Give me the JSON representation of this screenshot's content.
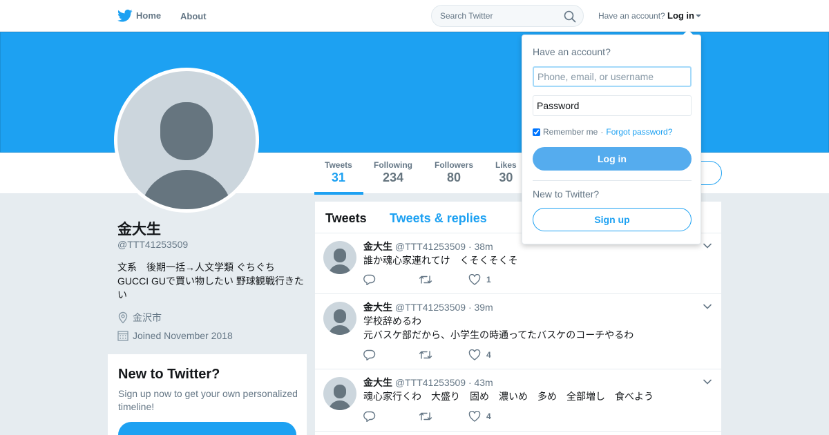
{
  "nav": {
    "home": "Home",
    "about": "About",
    "search_placeholder": "Search Twitter",
    "have_account": "Have an account?",
    "login": "Log in"
  },
  "stats": [
    {
      "label": "Tweets",
      "value": "31"
    },
    {
      "label": "Following",
      "value": "234"
    },
    {
      "label": "Followers",
      "value": "80"
    },
    {
      "label": "Likes",
      "value": "30"
    }
  ],
  "profile": {
    "name": "金大生",
    "handle": "@TTT41253509",
    "bio": "文系　後期一括→人文学類 ぐちぐち GUCCI GUで買い物したい 野球観戦行きたい",
    "location": "金沢市",
    "joined": "Joined November 2018"
  },
  "new_to_twitter": {
    "title": "New to Twitter?",
    "text": "Sign up now to get your own personalized timeline!"
  },
  "timeline": {
    "tabs": [
      "Tweets",
      "Tweets & replies"
    ],
    "tweets": [
      {
        "name": "金大生",
        "handle": "@TTT41253509",
        "time": "· 38m",
        "lines": [
          "誰か魂心家連れてけ　くそくそくそ"
        ],
        "likes": "1"
      },
      {
        "name": "金大生",
        "handle": "@TTT41253509",
        "time": "· 39m",
        "lines": [
          "学校辞めるわ",
          "元バスケ部だから、小学生の時通ってたバスケのコーチやるわ"
        ],
        "likes": "4"
      },
      {
        "name": "金大生",
        "handle": "@TTT41253509",
        "time": "· 43m",
        "lines": [
          "魂心家行くわ　大盛り　固め　濃いめ　多め　全部増し　食べよう"
        ],
        "likes": "4"
      }
    ]
  },
  "login_dropdown": {
    "title": "Have an account?",
    "username_placeholder": "Phone, email, or username",
    "password_placeholder": "Password",
    "remember": "Remember me",
    "separator": "·",
    "forgot": "Forgot password?",
    "login_button": "Log in",
    "new_prompt": "New to Twitter?",
    "signup_button": "Sign up"
  },
  "colors": {
    "brand": "#1da1f2",
    "banner": "#1da1f2",
    "background": "#e6ecf0"
  }
}
